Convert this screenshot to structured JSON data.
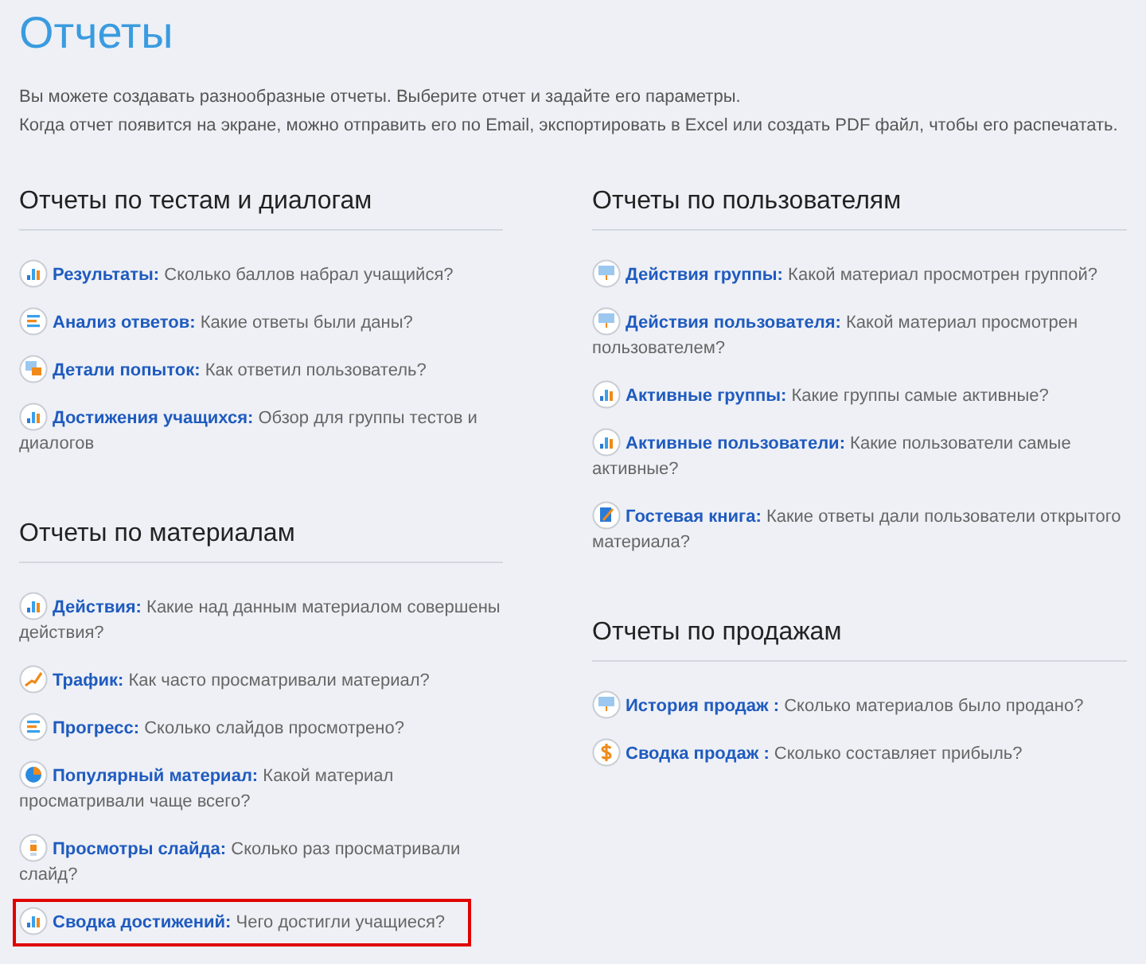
{
  "title": "Отчеты",
  "intro": [
    "Вы можете создавать разнообразные отчеты. Выберите отчет и задайте его параметры.",
    "Когда отчет появится на экране, можно отправить его по Email, экспортировать в Excel или создать PDF файл, чтобы его распечатать."
  ],
  "columns": [
    {
      "sections": [
        {
          "heading": "Отчеты по тестам и диалогам",
          "items": [
            {
              "kind": "bars",
              "title": "Результаты:",
              "description": "Сколько баллов набрал учащийся?",
              "highlighted": false
            },
            {
              "kind": "lines",
              "title": "Анализ ответов:",
              "description": "Какие ответы были даны?",
              "highlighted": false
            },
            {
              "kind": "attempts",
              "title": "Детали попыток:",
              "description": "Как ответил пользователь?",
              "highlighted": false
            },
            {
              "kind": "bars",
              "title": "Достижения учащихся:",
              "description": "Обзор для группы тестов и диалогов",
              "highlighted": false
            }
          ]
        },
        {
          "heading": "Отчеты по материалам",
          "items": [
            {
              "kind": "bars",
              "title": "Действия:",
              "description": "Какие над данным материалом совершены действия?",
              "highlighted": false
            },
            {
              "kind": "trend",
              "title": "Трафик:",
              "description": "Как часто просматривали материал?",
              "highlighted": false
            },
            {
              "kind": "lines",
              "title": "Прогресс:",
              "description": "Сколько слайдов просмотрено?",
              "highlighted": false
            },
            {
              "kind": "pie",
              "title": "Популярный материал:",
              "description": "Какой материал просматривали чаще всего?",
              "highlighted": false
            },
            {
              "kind": "slide",
              "title": "Просмотры слайда:",
              "description": "Сколько раз просматривали слайд?",
              "highlighted": false
            },
            {
              "kind": "bars",
              "title": "Сводка достижений:",
              "description": "Чего достигли учащиеся?",
              "highlighted": true
            }
          ]
        }
      ]
    },
    {
      "sections": [
        {
          "heading": "Отчеты по пользователям",
          "items": [
            {
              "kind": "screen",
              "title": "Действия группы:",
              "description": "Какой материал просмотрен группой?",
              "highlighted": false
            },
            {
              "kind": "screen",
              "title": "Действия пользователя:",
              "description": "Какой материал просмотрен пользователем?",
              "highlighted": false
            },
            {
              "kind": "bars",
              "title": "Активные группы:",
              "description": "Какие группы самые активные?",
              "highlighted": false
            },
            {
              "kind": "bars",
              "title": "Активные пользователи:",
              "description": "Какие пользователи самые активные?",
              "highlighted": false
            },
            {
              "kind": "book",
              "title": "Гостевая книга:",
              "description": "Какие ответы дали пользователи открытого материала?",
              "highlighted": false
            }
          ]
        },
        {
          "heading": "Отчеты по продажам",
          "items": [
            {
              "kind": "screen",
              "title": "История продаж :",
              "description": "Сколько материалов было продано?",
              "highlighted": false
            },
            {
              "kind": "dollar",
              "title": "Сводка продаж :",
              "description": "Сколько составляет прибыль?",
              "highlighted": false
            }
          ]
        }
      ]
    }
  ]
}
